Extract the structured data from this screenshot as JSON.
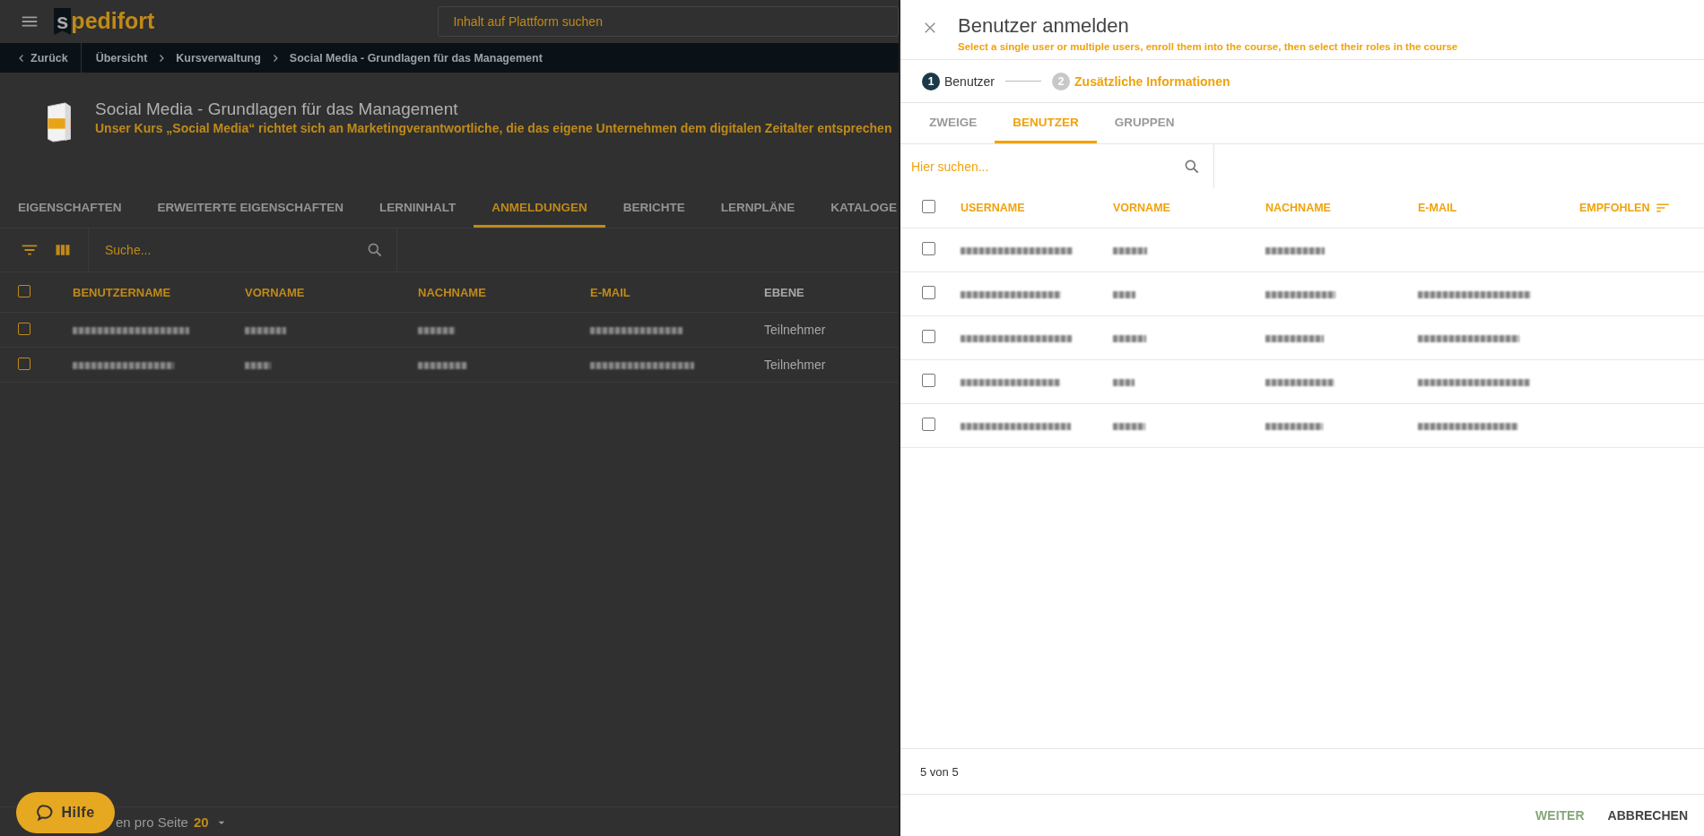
{
  "app": {
    "logo": {
      "mark": "s",
      "name": "pedifort"
    },
    "search": {
      "placeholder": "Inhalt auf Plattform suchen"
    }
  },
  "breadcrumb": {
    "back": "Zurück",
    "items": [
      "Übersicht",
      "Kursverwaltung",
      "Social Media - Grundlagen für das Management"
    ]
  },
  "course": {
    "title": "Social Media - Grundlagen für das Management",
    "description": "Unser Kurs „Social Media“ richtet sich an Marketingverantwortliche, die das eigene Unternehmen dem digitalen Zeitalter entsprechen"
  },
  "course_tabs": [
    {
      "label": "EIGENSCHAFTEN",
      "selected": false
    },
    {
      "label": "ERWEITERTE EIGENSCHAFTEN",
      "selected": false
    },
    {
      "label": "LERNINHALT",
      "selected": false
    },
    {
      "label": "ANMELDUNGEN",
      "selected": true
    },
    {
      "label": "BERICHTE",
      "selected": false
    },
    {
      "label": "LERNPLÄNE",
      "selected": false
    },
    {
      "label": "KATALOGE",
      "selected": false
    }
  ],
  "enrollments": {
    "search": {
      "placeholder": "Suche..."
    },
    "select_all": {
      "checked": false
    },
    "columns": [
      "BENUTZERNAME",
      "VORNAME",
      "NACHNAME",
      "E-MAIL",
      "EBENE"
    ],
    "rows": [
      {
        "checked": false,
        "level": "Teilnehmer"
      },
      {
        "checked": false,
        "level": "Teilnehmer"
      }
    ],
    "pagination": {
      "label": "en pro Seite",
      "value": "20"
    }
  },
  "help_button": {
    "label": "Hilfe"
  },
  "dialog": {
    "title": "Benutzer anmelden",
    "subtitle": "Select a single user or multiple users, enroll them into the course, then select their roles in the course",
    "steps": [
      {
        "number": "1",
        "label": "Benutzer",
        "active": true
      },
      {
        "number": "2",
        "label": "Zusätzliche Informationen",
        "active": false
      }
    ],
    "tabs": [
      {
        "label": "ZWEIGE",
        "selected": false
      },
      {
        "label": "BENUTZER",
        "selected": true
      },
      {
        "label": "GRUPPEN",
        "selected": false
      }
    ],
    "search": {
      "placeholder": "Hier suchen..."
    },
    "select_all": {
      "checked": false
    },
    "columns": [
      "USERNAME",
      "VORNAME",
      "NACHNAME",
      "E-MAIL",
      "EMPFOHLEN"
    ],
    "rows": [
      {
        "checked": false,
        "kind": "no_email"
      },
      {
        "checked": false,
        "kind": "complete"
      },
      {
        "checked": false,
        "kind": "complete"
      },
      {
        "checked": false,
        "kind": "complete"
      },
      {
        "checked": false,
        "kind": "complete"
      }
    ],
    "count": "5 von 5",
    "buttons": [
      {
        "label": "WEITER",
        "kind": "primary",
        "disabled": true
      },
      {
        "label": "ABBRECHEN",
        "kind": "secondary",
        "disabled": false
      }
    ]
  }
}
